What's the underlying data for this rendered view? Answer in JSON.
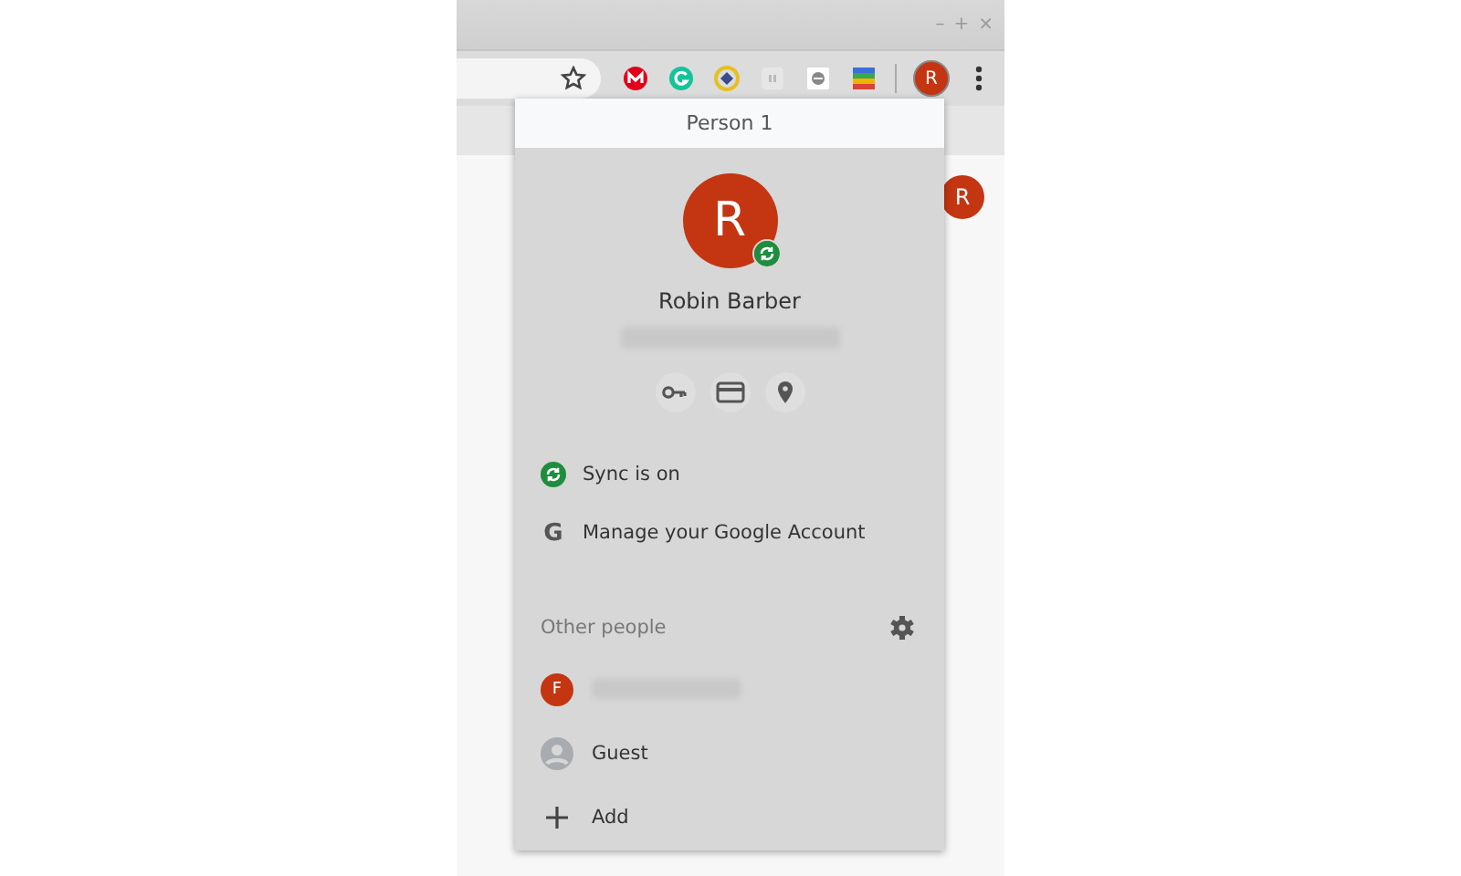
{
  "window": {
    "controls": [
      "–",
      "+",
      "×"
    ]
  },
  "toolbar": {
    "profile_initial": "R"
  },
  "page": {
    "avatar_initial": "R"
  },
  "profile_menu": {
    "title": "Person 1",
    "profile": {
      "initial": "R",
      "name": "Robin Barber",
      "synced": true
    },
    "items": [
      {
        "kind": "sync",
        "label": "Sync is on"
      },
      {
        "kind": "google",
        "icon": "G",
        "label": "Manage your Google Account"
      }
    ],
    "other_people": {
      "heading": "Other people",
      "people": [
        {
          "kind": "profile",
          "initial": "F"
        },
        {
          "kind": "guest",
          "label": "Guest"
        },
        {
          "kind": "add",
          "label": "Add"
        }
      ]
    }
  }
}
